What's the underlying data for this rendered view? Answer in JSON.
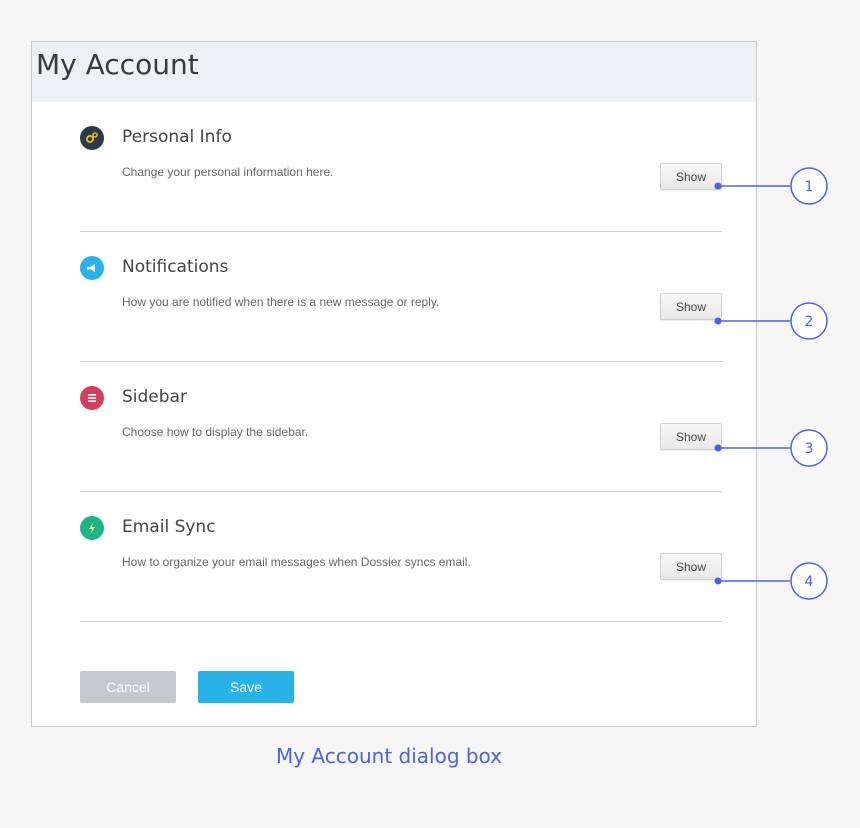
{
  "dialog": {
    "title": "My Account",
    "sections": [
      {
        "label": "Personal Info",
        "description": "Change your personal information here.",
        "button": "Show",
        "icon": "gears-icon",
        "icon_color": "#2b3a4a",
        "callout": "1"
      },
      {
        "label": "Notifications",
        "description": "How you are notified when there is a new message or reply.",
        "button": "Show",
        "icon": "megaphone-icon",
        "icon_color": "#29b2e8",
        "callout": "2"
      },
      {
        "label": "Sidebar",
        "description": "Choose how to display the sidebar.",
        "button": "Show",
        "icon": "list-icon",
        "icon_color": "#d2405e",
        "callout": "3"
      },
      {
        "label": "Email Sync",
        "description": "How to organize your email messages when Dossier syncs email.",
        "button": "Show",
        "icon": "lightning-icon",
        "icon_color": "#1db58a",
        "callout": "4"
      }
    ],
    "cancel_label": "Cancel",
    "save_label": "Save"
  },
  "caption": "My Account dialog box",
  "colors": {
    "accent": "#29b2e8",
    "callout": "#4a63e0",
    "header_bg": "#edf1f4"
  }
}
